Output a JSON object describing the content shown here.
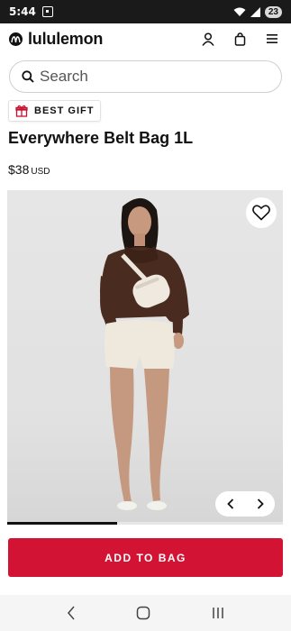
{
  "status_bar": {
    "time": "5:44",
    "battery": "23"
  },
  "header": {
    "brand": "lululemon"
  },
  "search": {
    "placeholder": "Search"
  },
  "badge": {
    "label": "BEST GIFT"
  },
  "product": {
    "title": "Everywhere Belt Bag 1L",
    "price": "$38",
    "currency": "USD",
    "carousel_progress": 0.4
  },
  "cta": {
    "add_to_bag": "ADD TO BAG"
  },
  "colors": {
    "accent": "#d31334",
    "badge_icon": "#c8102e"
  },
  "icons": [
    "account-icon",
    "bag-icon",
    "menu-icon",
    "search-icon",
    "gift-icon",
    "heart-icon",
    "chevron-left-icon",
    "chevron-right-icon"
  ]
}
